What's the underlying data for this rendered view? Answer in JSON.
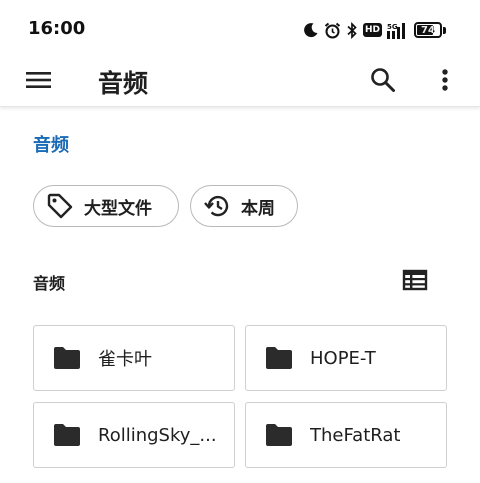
{
  "status_bar": {
    "time": "16:00",
    "icons": [
      "moon-icon",
      "alarm-icon",
      "bluetooth-icon",
      "hd-icon",
      "signal-5g-icon"
    ],
    "hd_label": "HD",
    "battery_level": "74",
    "battery_fraction": 0.74
  },
  "app_bar": {
    "title": "音频",
    "icons": [
      "menu-icon",
      "search-icon",
      "more-vert-icon"
    ]
  },
  "breadcrumb": {
    "current": "音频",
    "color": "#1a6bb5"
  },
  "filter_chips": [
    {
      "label": "大型文件",
      "icon": "tag-icon"
    },
    {
      "label": "本周",
      "icon": "history-icon"
    }
  ],
  "section": {
    "title": "音频",
    "view_toggle_icon": "list-view-icon"
  },
  "folders": [
    {
      "name": "雀卡叶",
      "icon": "folder-icon"
    },
    {
      "name": "HOPE-T",
      "icon": "folder-icon"
    },
    {
      "name": "RollingSky_...",
      "icon": "folder-icon"
    },
    {
      "name": "TheFatRat",
      "icon": "folder-icon"
    }
  ]
}
